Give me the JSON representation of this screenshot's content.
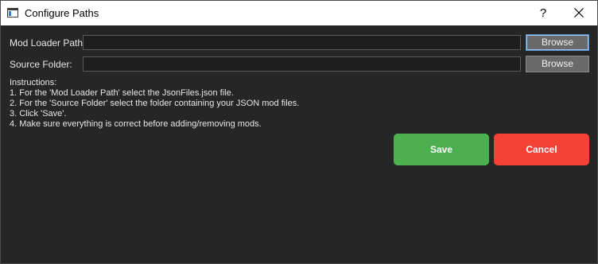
{
  "window": {
    "title": "Configure Paths",
    "help_label": "?",
    "icons": {
      "app": "window-icon",
      "close": "close-icon"
    }
  },
  "form": {
    "mod_loader": {
      "label": "Mod Loader Path:",
      "value": "",
      "browse_label": "Browse"
    },
    "source_folder": {
      "label": "Source Folder:",
      "value": "",
      "browse_label": "Browse"
    }
  },
  "instructions": {
    "heading": "Instructions:",
    "lines": [
      "1. For the 'Mod Loader Path' select the JsonFiles.json file.",
      "2. For the 'Source Folder' select the folder containing your JSON mod files.",
      "3. Click 'Save'.",
      "4. Make sure everything is correct before adding/removing mods."
    ]
  },
  "actions": {
    "save_label": "Save",
    "cancel_label": "Cancel"
  },
  "colors": {
    "background": "#262626",
    "save": "#4caf50",
    "cancel": "#f44336",
    "browse": "#6a6a6a",
    "focus": "#4b8fd6"
  }
}
